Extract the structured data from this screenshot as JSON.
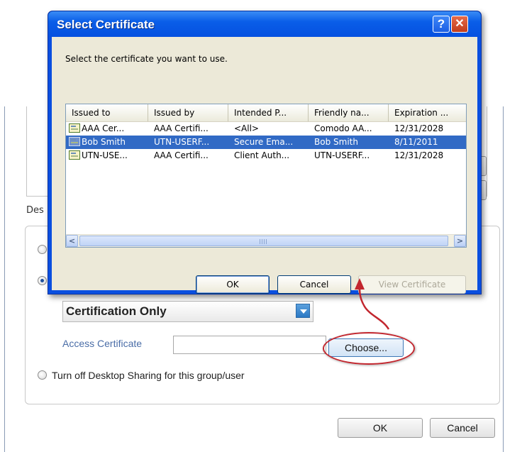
{
  "dialog": {
    "title": "Select Certificate",
    "help_label": "?",
    "close_label": "✕",
    "prompt": "Select the certificate you want to use.",
    "columns": [
      "Issued to",
      "Issued by",
      "Intended P...",
      "Friendly na...",
      "Expiration ..."
    ],
    "rows": [
      {
        "issued_to": "AAA Cer...",
        "issued_by": "AAA Certifi...",
        "intended": "<All>",
        "friendly": "Comodo AA...",
        "expiration": "12/31/2028",
        "selected": false
      },
      {
        "issued_to": "Bob Smith",
        "issued_by": "UTN-USERF...",
        "intended": "Secure Ema...",
        "friendly": "Bob Smith",
        "expiration": "8/11/2011",
        "selected": true
      },
      {
        "issued_to": "UTN-USE...",
        "issued_by": "AAA Certifi...",
        "intended": "Client Auth...",
        "friendly": "UTN-USERF...",
        "expiration": "12/31/2028",
        "selected": false
      }
    ],
    "scroll_left": "<",
    "scroll_right": ">",
    "ok_label": "OK",
    "cancel_label": "Cancel",
    "view_certificate_label": "View Certificate"
  },
  "background": {
    "desc_label": "Des",
    "certification_select": "Certification Only",
    "access_certificate_label": "Access Certificate",
    "choose_label": "Choose...",
    "turn_off_label": "Turn off Desktop Sharing for this group/user",
    "ok_label": "OK",
    "cancel_label": "Cancel"
  },
  "colors": {
    "title_bar": "#0a5ee8",
    "selection": "#316ac5",
    "annotation": "#c2262e",
    "accent_label": "#4a6da7"
  }
}
